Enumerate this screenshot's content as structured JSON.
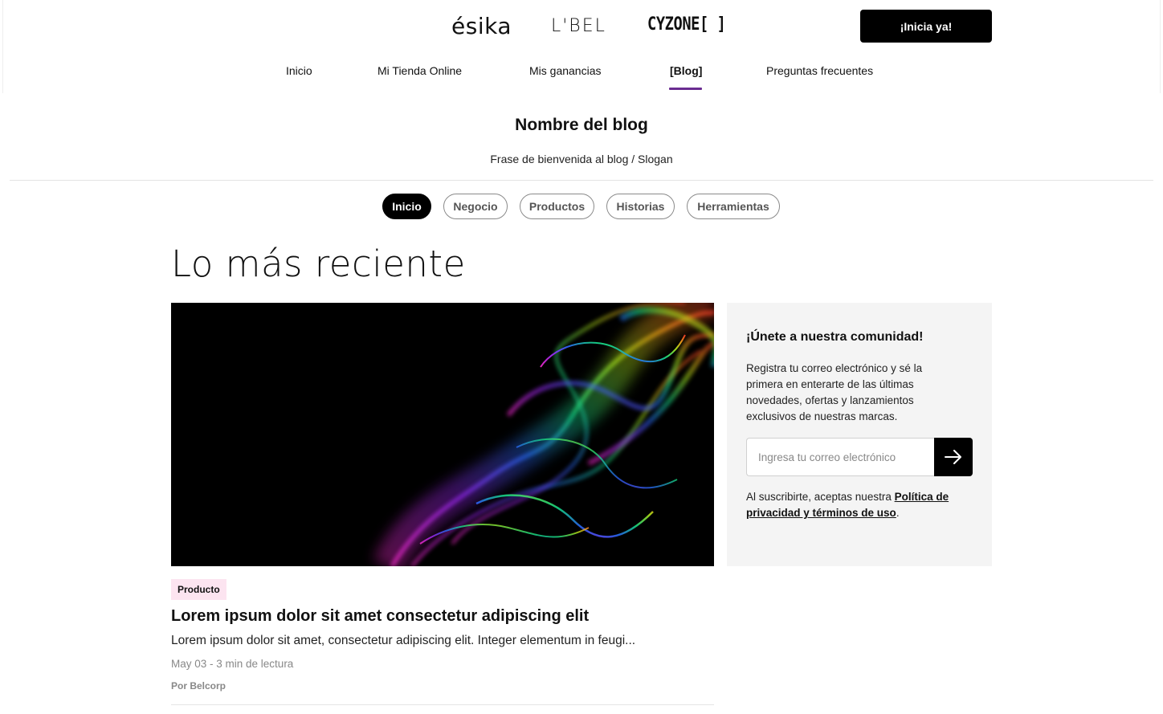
{
  "header": {
    "brands": [
      "ésika",
      "L'BEL",
      "CYZONE[ ]"
    ],
    "cta_label": "¡Inicia ya!"
  },
  "nav": {
    "items": [
      {
        "label": "Inicio",
        "active": false
      },
      {
        "label": "Mi Tienda Online",
        "active": false
      },
      {
        "label": "Mis ganancias",
        "active": false
      },
      {
        "label": "[Blog]",
        "active": true
      },
      {
        "label": "Preguntas frecuentes",
        "active": false
      }
    ],
    "accent_color": "#6a2c91"
  },
  "blog": {
    "title": "Nombre del blog",
    "slogan": "Frase de bienvenida al blog / Slogan"
  },
  "categories": [
    {
      "label": "Inicio",
      "active": true
    },
    {
      "label": "Negocio",
      "active": false
    },
    {
      "label": "Productos",
      "active": false
    },
    {
      "label": "Historias",
      "active": false
    },
    {
      "label": "Herramientas",
      "active": false
    }
  ],
  "section": {
    "title": "Lo más reciente"
  },
  "featured_post": {
    "tag": "Producto",
    "tag_color": "#fce4f0",
    "title": "Lorem ipsum dolor sit amet consectetur adipiscing elit",
    "excerpt": "Lorem ipsum dolor sit amet, consectetur adipiscing elit. Integer elementum in feugi...",
    "meta": "May 03 - 3 min de lectura",
    "author": "Por Belcorp",
    "image": "colorful-rainbow-smoke-on-black"
  },
  "community": {
    "title": "¡Únete a nuestra comunidad!",
    "text": "Registra tu correo electrónico y sé la primera en enterarte de las últimas novedades, ofertas y lanzamientos exclusivos de nuestras marcas.",
    "email_placeholder": "Ingresa tu correo electrónico",
    "submit_icon": "arrow-right-icon",
    "legal_prefix": "Al suscribirte, aceptas nuestra ",
    "legal_link": "Política de privacidad y términos de uso",
    "legal_suffix": "."
  }
}
